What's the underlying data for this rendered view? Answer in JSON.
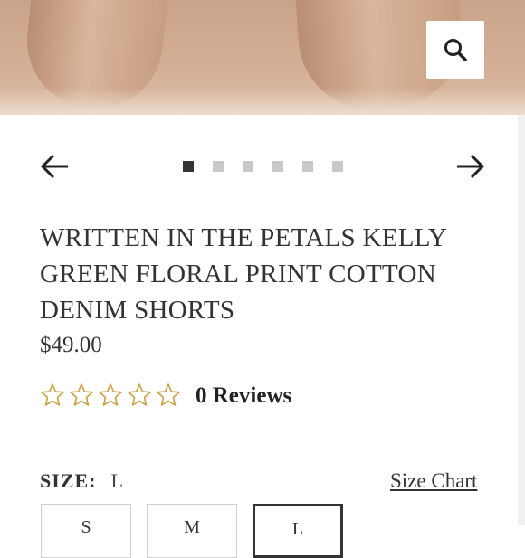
{
  "product": {
    "title": "WRITTEN IN THE PETALS KELLY GREEN FLORAL PRINT COTTON DENIM SHORTS",
    "price": "$49.00",
    "rating_stars": 0,
    "reviews_label": "0 Reviews"
  },
  "gallery": {
    "image_count": 6,
    "active_index": 0,
    "prev_icon": "arrow-left-icon",
    "next_icon": "arrow-right-icon",
    "zoom_icon": "search-icon"
  },
  "size": {
    "label": "SIZE:",
    "selected_value": "L",
    "chart_link": "Size Chart",
    "options": [
      "S",
      "M",
      "L"
    ],
    "selected_option": 2
  },
  "colors": {
    "text": "#333333",
    "star_outline": "#c9a24a",
    "dot_active": "#333333",
    "dot_inactive": "#c8c8c8"
  }
}
